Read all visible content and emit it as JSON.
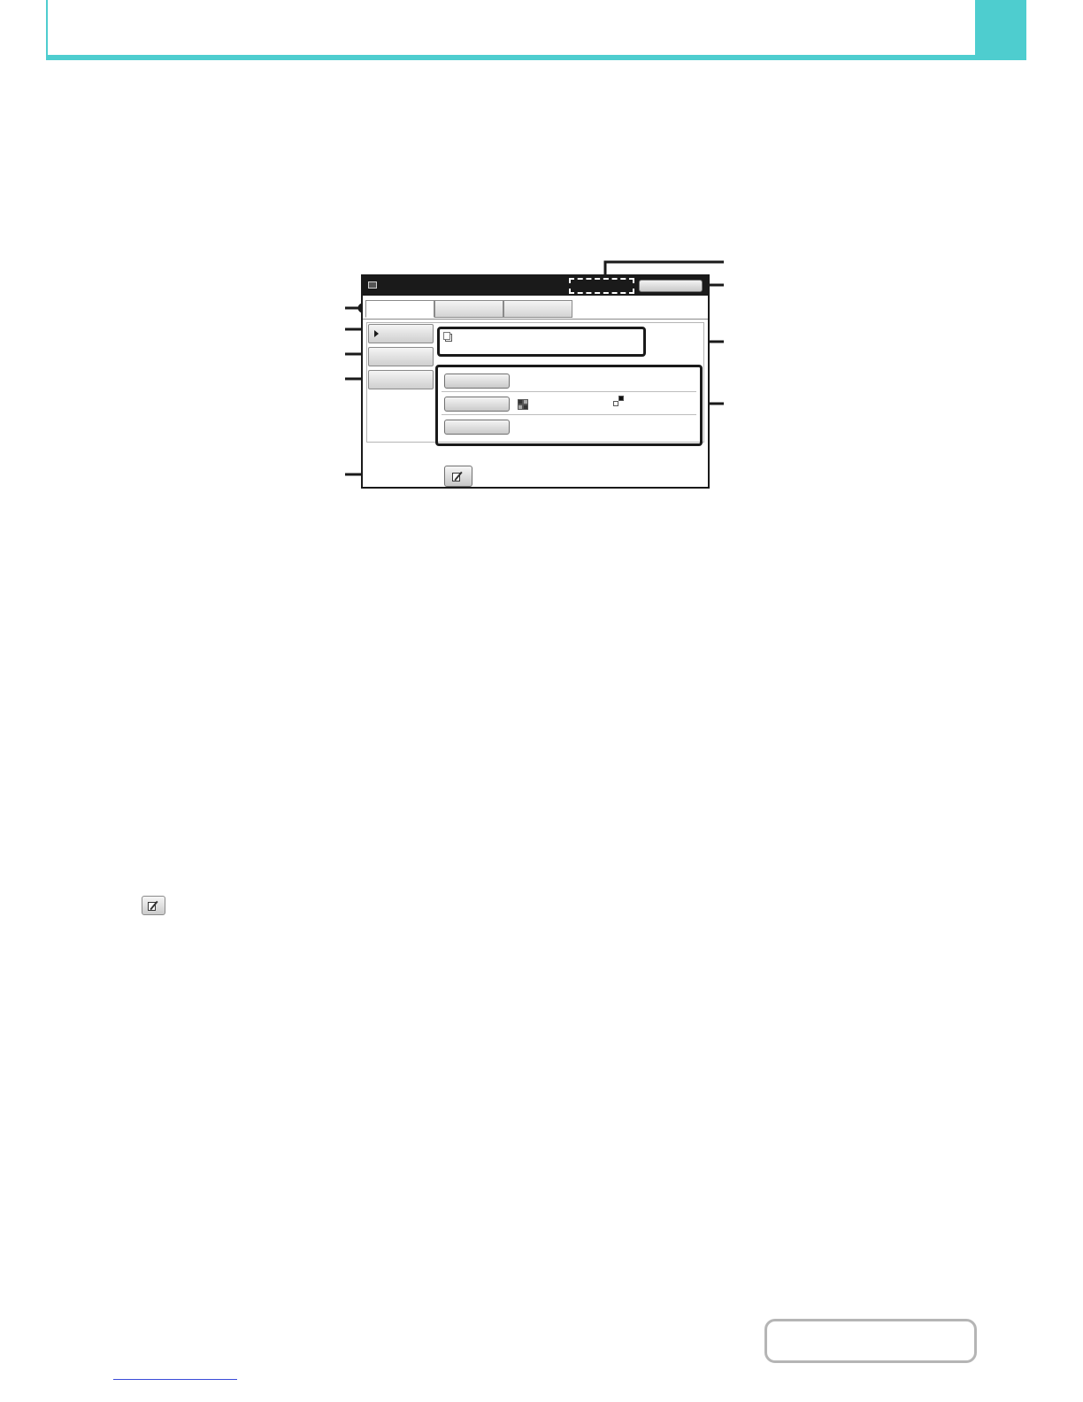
{
  "page": {
    "header_color": "#4ecdcf",
    "link_color": "#3a4bd8"
  },
  "diagram": {
    "icons": {
      "mode": "display-mode-icon",
      "info": "document-icon",
      "edit": "edit-document-icon",
      "row_arrow": "triangle-right-icon"
    },
    "tabs": [
      "",
      "",
      ""
    ],
    "side_buttons": [
      "",
      "",
      ""
    ],
    "settings_rows": [
      "",
      "",
      ""
    ]
  }
}
